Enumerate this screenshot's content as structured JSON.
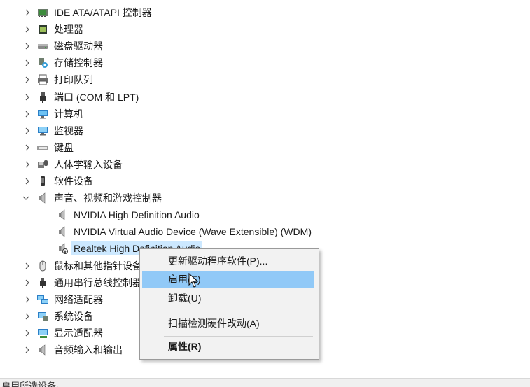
{
  "tree": {
    "items": [
      {
        "label": "IDE ATA/ATAPI 控制器",
        "icon": "ide-controller-icon",
        "expanded": false
      },
      {
        "label": "处理器",
        "icon": "processor-icon",
        "expanded": false
      },
      {
        "label": "磁盘驱动器",
        "icon": "disk-drive-icon",
        "expanded": false
      },
      {
        "label": "存储控制器",
        "icon": "storage-controller-icon",
        "expanded": false
      },
      {
        "label": "打印队列",
        "icon": "printer-icon",
        "expanded": false
      },
      {
        "label": "端口 (COM 和 LPT)",
        "icon": "port-icon",
        "expanded": false
      },
      {
        "label": "计算机",
        "icon": "computer-icon",
        "expanded": false
      },
      {
        "label": "监视器",
        "icon": "monitor-icon",
        "expanded": false
      },
      {
        "label": "键盘",
        "icon": "keyboard-icon",
        "expanded": false
      },
      {
        "label": "人体学输入设备",
        "icon": "hid-icon",
        "expanded": false
      },
      {
        "label": "软件设备",
        "icon": "software-device-icon",
        "expanded": false
      },
      {
        "label": "声音、视频和游戏控制器",
        "icon": "speaker-icon",
        "expanded": true
      },
      {
        "label": "NVIDIA High Definition Audio",
        "icon": "speaker-icon",
        "child": true
      },
      {
        "label": "NVIDIA Virtual Audio Device (Wave Extensible) (WDM)",
        "icon": "speaker-icon",
        "child": true
      },
      {
        "label": "Realtek High Definition Audio",
        "icon": "speaker-disabled-icon",
        "child": true,
        "selected": true
      },
      {
        "label": "鼠标和其他指针设备",
        "icon": "mouse-icon",
        "expanded": false
      },
      {
        "label": "通用串行总线控制器",
        "icon": "usb-icon",
        "expanded": false
      },
      {
        "label": "网络适配器",
        "icon": "network-adapter-icon",
        "expanded": false
      },
      {
        "label": "系统设备",
        "icon": "system-device-icon",
        "expanded": false
      },
      {
        "label": "显示适配器",
        "icon": "display-adapter-icon",
        "expanded": false
      },
      {
        "label": "音频输入和输出",
        "icon": "audio-io-icon",
        "expanded": false
      }
    ]
  },
  "context_menu": {
    "items": [
      {
        "label": "更新驱动程序软件(P)...",
        "hover": false,
        "bold": false
      },
      {
        "label": "启用(E)",
        "hover": true,
        "bold": false
      },
      {
        "label": "卸载(U)",
        "hover": false,
        "bold": false
      },
      {
        "label": "扫描检测硬件改动(A)",
        "hover": false,
        "bold": false
      },
      {
        "label": "属性(R)",
        "hover": false,
        "bold": true
      }
    ]
  },
  "status_bar": {
    "text": "启用所选设备。"
  },
  "colors": {
    "selection": "#cce8ff",
    "menu_hover": "#91c9f7",
    "menu_bg": "#f2f2f2"
  }
}
